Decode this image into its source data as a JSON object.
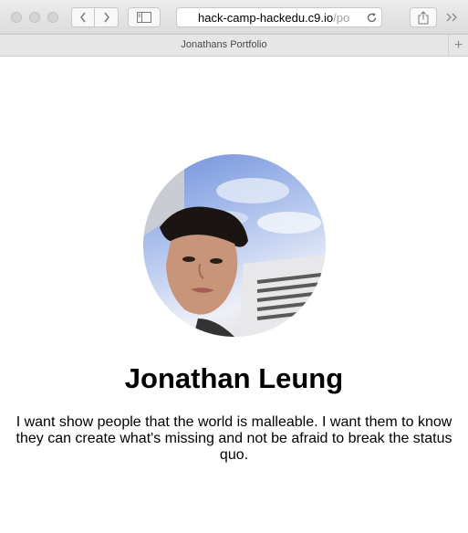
{
  "browser": {
    "url_main": "hack-camp-hackedu.c9.io",
    "url_rest": "/po",
    "tab_title": "Jonathans Portfolio",
    "icons": [
      "back-icon",
      "forward-icon",
      "sidebar-icon",
      "reload-icon",
      "share-icon",
      "overflow-icon",
      "new-tab-icon"
    ]
  },
  "profile": {
    "name": "Jonathan Leung",
    "bio": "I want show people that the world is malleable. I want them to know they can create what's missing and not be afraid to break the status quo."
  }
}
